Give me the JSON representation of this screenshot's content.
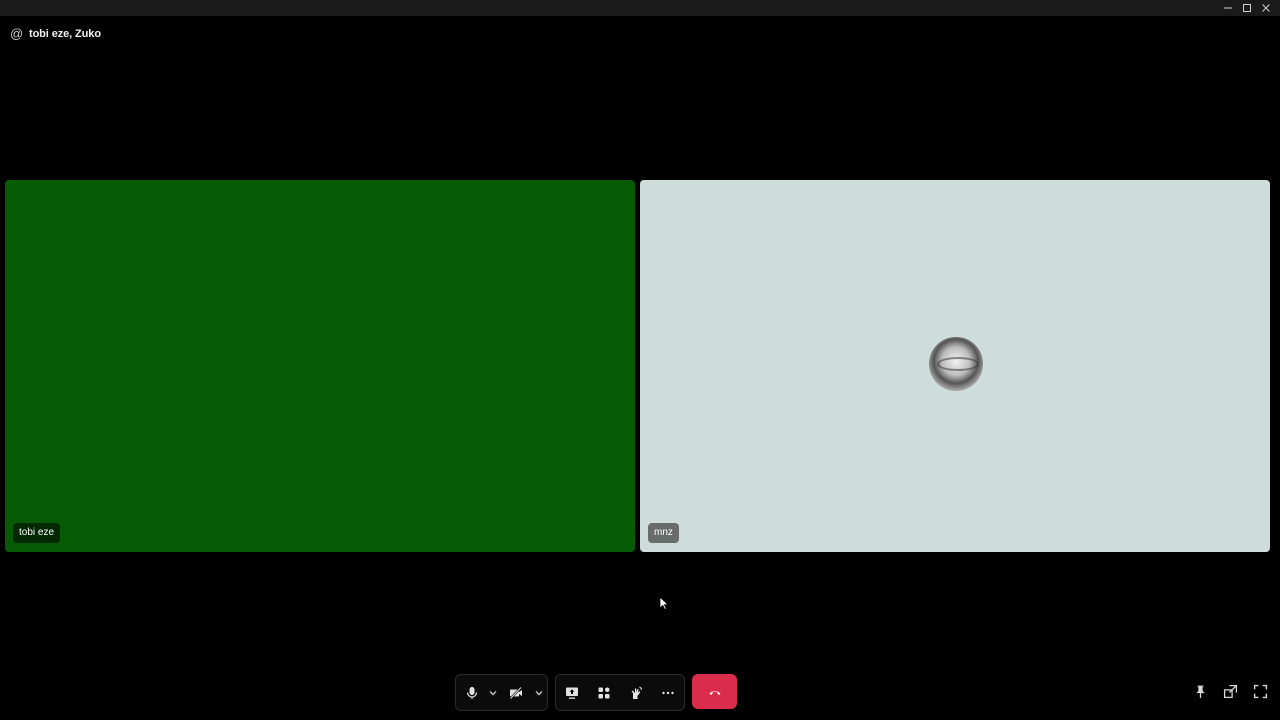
{
  "window": {
    "controls": [
      "minimize-icon",
      "maximize-icon",
      "close-icon"
    ]
  },
  "header": {
    "icon": "at-icon",
    "title": "tobi eze, Zuko"
  },
  "tiles": [
    {
      "name": "tobi eze",
      "background": "#065b04"
    },
    {
      "name": "mnz",
      "background": "#cedddc",
      "avatar": "avatar-image"
    }
  ],
  "controls": {
    "microphone": "microphone-icon",
    "camera": "camera-off-icon",
    "share_screen": "screen-share-icon",
    "activities": "activities-icon",
    "soundboard": "soundboard-icon",
    "more": "more-icon",
    "end_call": "end-call-icon",
    "end_call_color": "#da2c4b"
  },
  "right_tools": [
    "pin-icon",
    "pop-out-icon",
    "fullscreen-icon"
  ]
}
